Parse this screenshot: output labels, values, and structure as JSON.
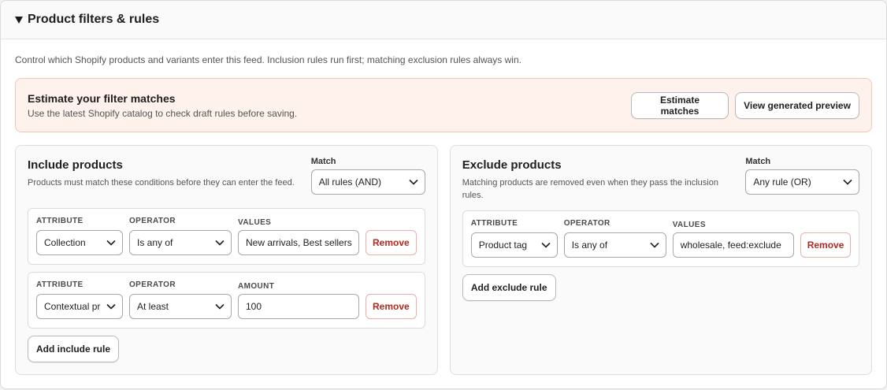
{
  "header": {
    "title": "Product filters & rules"
  },
  "intro": "Control which Shopify products and variants enter this feed. Inclusion rules run first; matching exclusion rules always win.",
  "banner": {
    "title": "Estimate your filter matches",
    "subtitle": "Use the latest Shopify catalog to check draft rules before saving.",
    "estimate_label": "Estimate matches",
    "preview_label": "View generated preview",
    "bg_color": "#fff1ec"
  },
  "include": {
    "title": "Include products",
    "description": "Products must match these conditions before they can enter the feed.",
    "match_label": "Match",
    "match_value": "All rules (AND)",
    "rules": [
      {
        "attribute_label": "ATTRIBUTE",
        "attribute": "Collection",
        "operator_label": "OPERATOR",
        "operator": "Is any of",
        "value_label": "VALUES",
        "value": "New arrivals, Best sellers",
        "remove_label": "Remove"
      },
      {
        "attribute_label": "ATTRIBUTE",
        "attribute": "Contextual pr",
        "operator_label": "OPERATOR",
        "operator": "At least",
        "value_label": "AMOUNT",
        "value": "100",
        "remove_label": "Remove"
      }
    ],
    "add_label": "Add include rule"
  },
  "exclude": {
    "title": "Exclude products",
    "description": "Matching products are removed even when they pass the inclusion rules.",
    "match_label": "Match",
    "match_value": "Any rule (OR)",
    "rules": [
      {
        "attribute_label": "ATTRIBUTE",
        "attribute": "Product tag",
        "operator_label": "OPERATOR",
        "operator": "Is any of",
        "value_label": "VALUES",
        "value": "wholesale, feed:exclude",
        "remove_label": "Remove"
      }
    ],
    "add_label": "Add exclude rule"
  },
  "colors": {
    "remove_text": "#b02a20",
    "remove_border": "#e9b0ab"
  }
}
